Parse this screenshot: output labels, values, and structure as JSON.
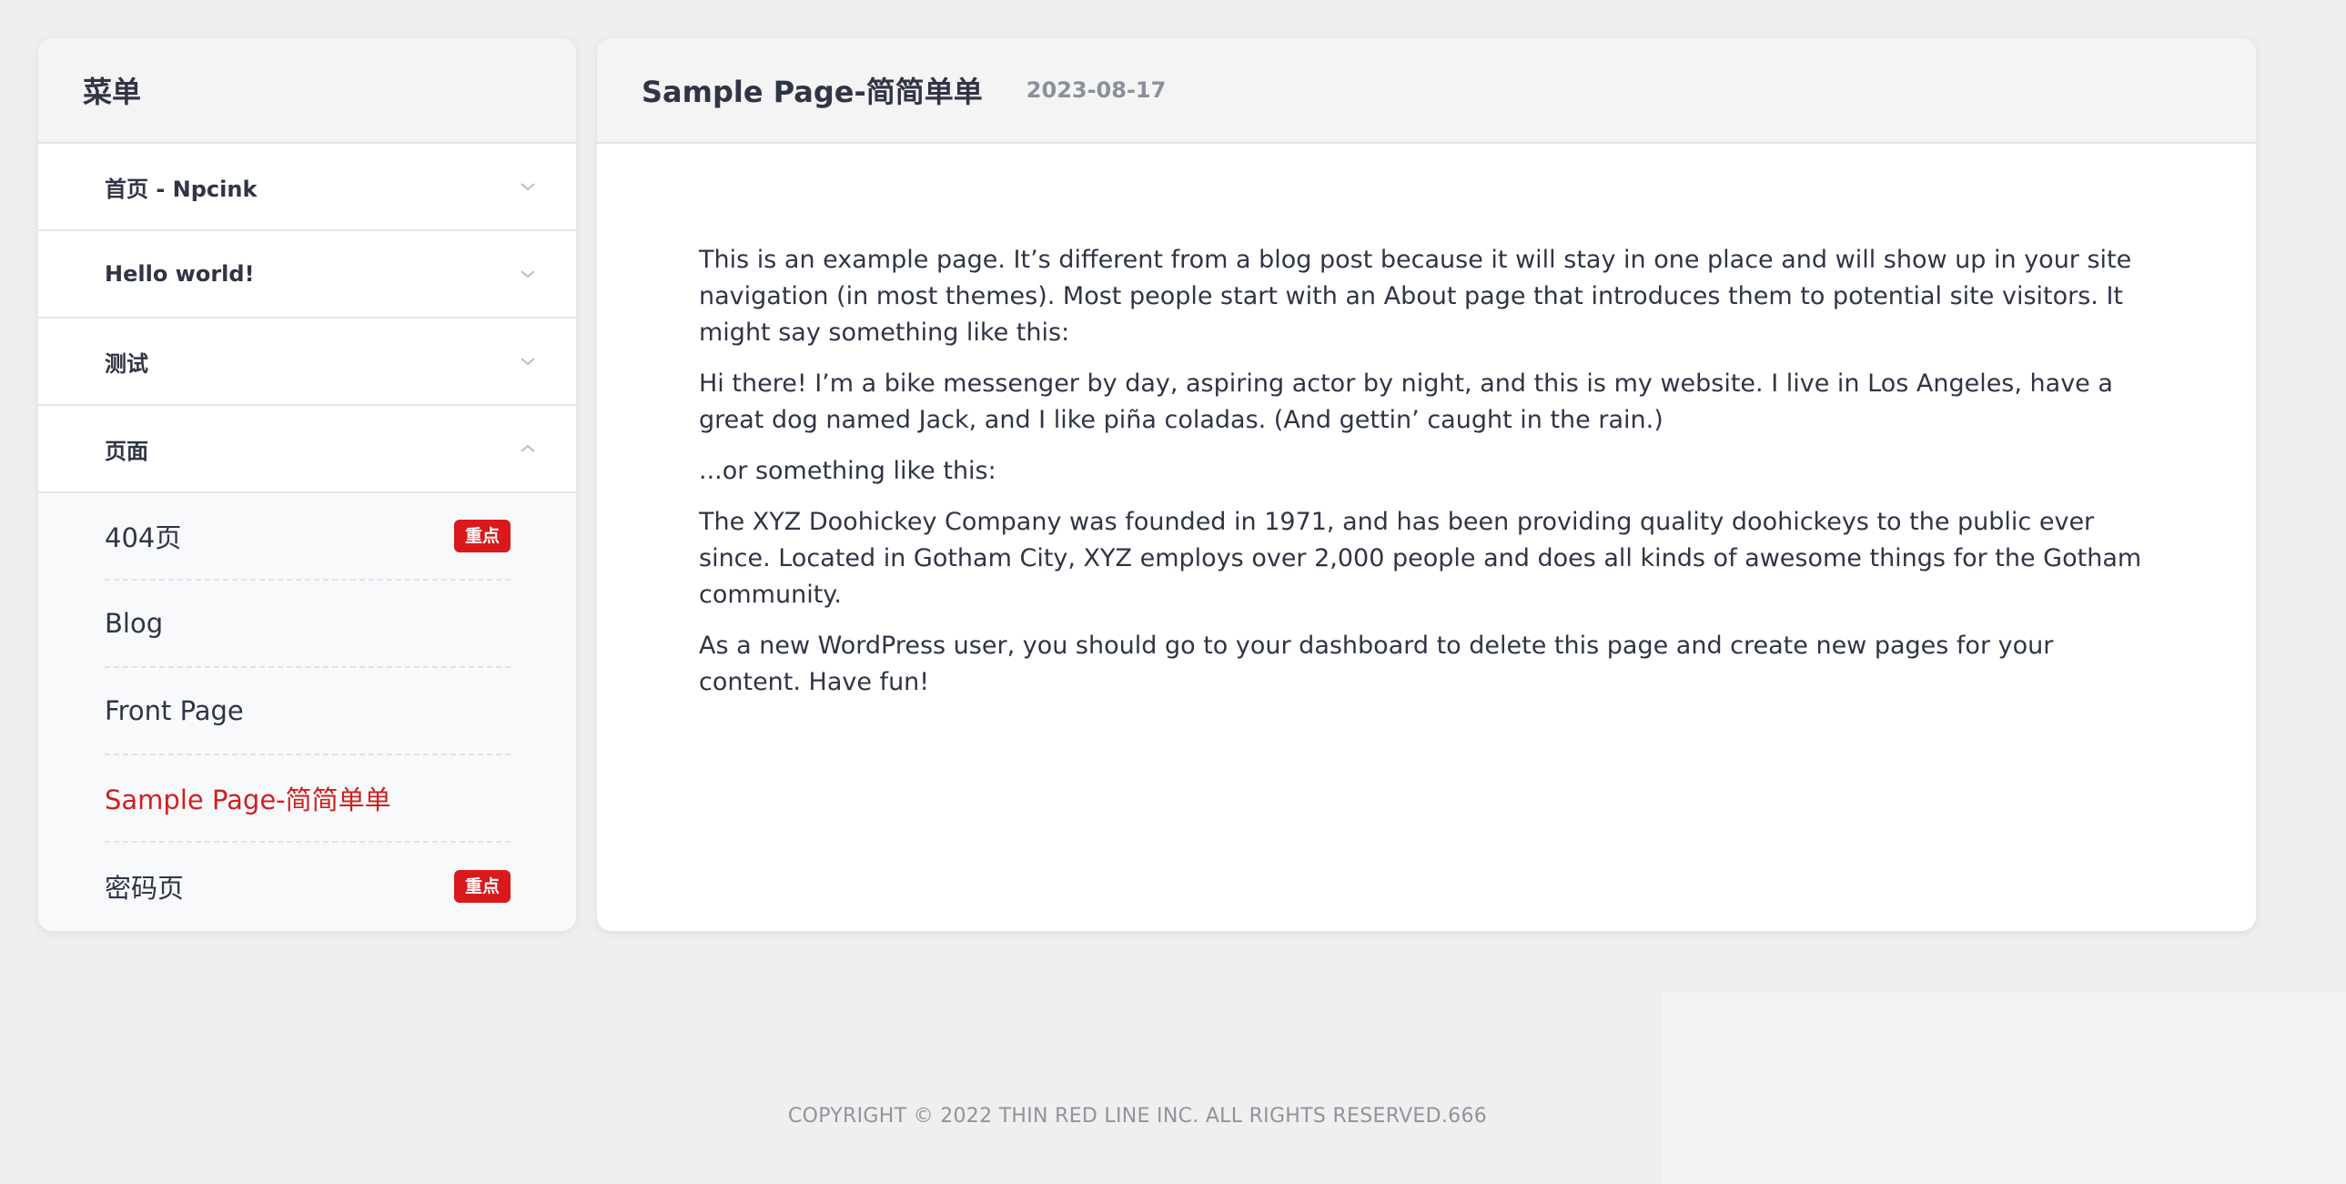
{
  "sidebar": {
    "title": "菜单",
    "items": [
      {
        "label": "首页 - Npcink",
        "icon": "chevron-down-icon"
      },
      {
        "label": "Hello world!",
        "icon": "chevron-down-icon"
      },
      {
        "label": "测试",
        "icon": "chevron-down-icon"
      },
      {
        "label": "页面",
        "icon": "chevron-up-icon"
      }
    ],
    "subitems": [
      {
        "label": "404页",
        "badge": "重点"
      },
      {
        "label": "Blog"
      },
      {
        "label": "Front Page"
      },
      {
        "label": "Sample Page-简简单单",
        "active": true
      },
      {
        "label": "密码页",
        "badge": "重点"
      }
    ]
  },
  "article": {
    "title": "Sample Page-简简单单",
    "date": "2023-08-17",
    "paragraphs": [
      "This is an example page. It’s different from a blog post because it will stay in one place and will show up in your site navigation (in most themes). Most people start with an About page that introduces them to potential site visitors. It might say something like this:",
      "Hi there! I’m a bike messenger by day, aspiring actor by night, and this is my website. I live in Los Angeles, have a great dog named Jack, and I like piña coladas. (And gettin’ caught in the rain.)",
      "...or something like this:",
      "The XYZ Doohickey Company was founded in 1971, and has been providing quality doohickeys to the public ever since. Located in Gotham City, XYZ employs over 2,000 people and does all kinds of awesome things for the Gotham community.",
      "As a new WordPress user, you should go to your dashboard to delete this page and create new pages for your content. Have fun!"
    ]
  },
  "footer": {
    "copyright": "COPYRIGHT © 2022 THIN RED LINE INC. ALL RIGHTS RESERVED.666"
  },
  "colors": {
    "background": "#efefef",
    "active": "#d11f1f",
    "badge": "#d9191c",
    "text": "#2f3545"
  }
}
